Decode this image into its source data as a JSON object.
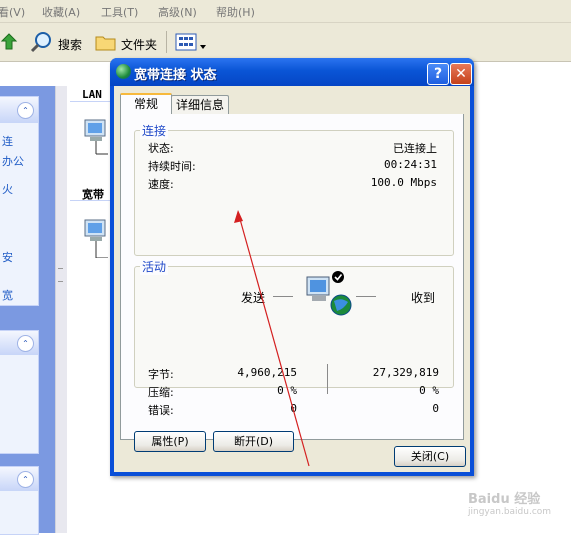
{
  "menubar": {
    "items": [
      "看(V)",
      "收藏(A)",
      "工具(T)",
      "高级(N)",
      "帮助(H)"
    ]
  },
  "toolbar": {
    "search_label": "搜索",
    "folders_label": "文件夹"
  },
  "sidebar": {
    "panel1_links": [
      "连",
      "办公",
      "火",
      "",
      "安",
      "宽"
    ]
  },
  "content": {
    "lan_heading": "LAN",
    "broadband_heading": "宽带"
  },
  "dialog": {
    "title": "宽带连接 状态",
    "help_glyph": "?",
    "close_glyph": "✕",
    "tabs": [
      "常规",
      "详细信息"
    ],
    "connection_group": {
      "title": "连接",
      "rows": [
        {
          "label": "状态:",
          "value": "已连接上"
        },
        {
          "label": "持续时间:",
          "value": "00:24:31"
        },
        {
          "label": "速度:",
          "value": "100.0 Mbps"
        }
      ]
    },
    "activity_group": {
      "title": "活动",
      "send_label": "发送",
      "receive_label": "收到",
      "rows": [
        {
          "label": "字节:",
          "sent": "4,960,215",
          "received": "27,329,819"
        },
        {
          "label": "压缩:",
          "sent": "0 %",
          "received": "0 %"
        },
        {
          "label": "错误:",
          "sent": "0",
          "received": "0"
        }
      ]
    },
    "buttons": {
      "properties": "属性(P)",
      "disconnect": "断开(D)",
      "close": "关闭(C)"
    }
  },
  "watermark": {
    "brand": "Baidu 经验",
    "url": "jingyan.baidu.com"
  },
  "colors": {
    "title_blue": "#0a55d6",
    "group_title": "#1f48c8",
    "annotation_arrow": "#d42020"
  }
}
